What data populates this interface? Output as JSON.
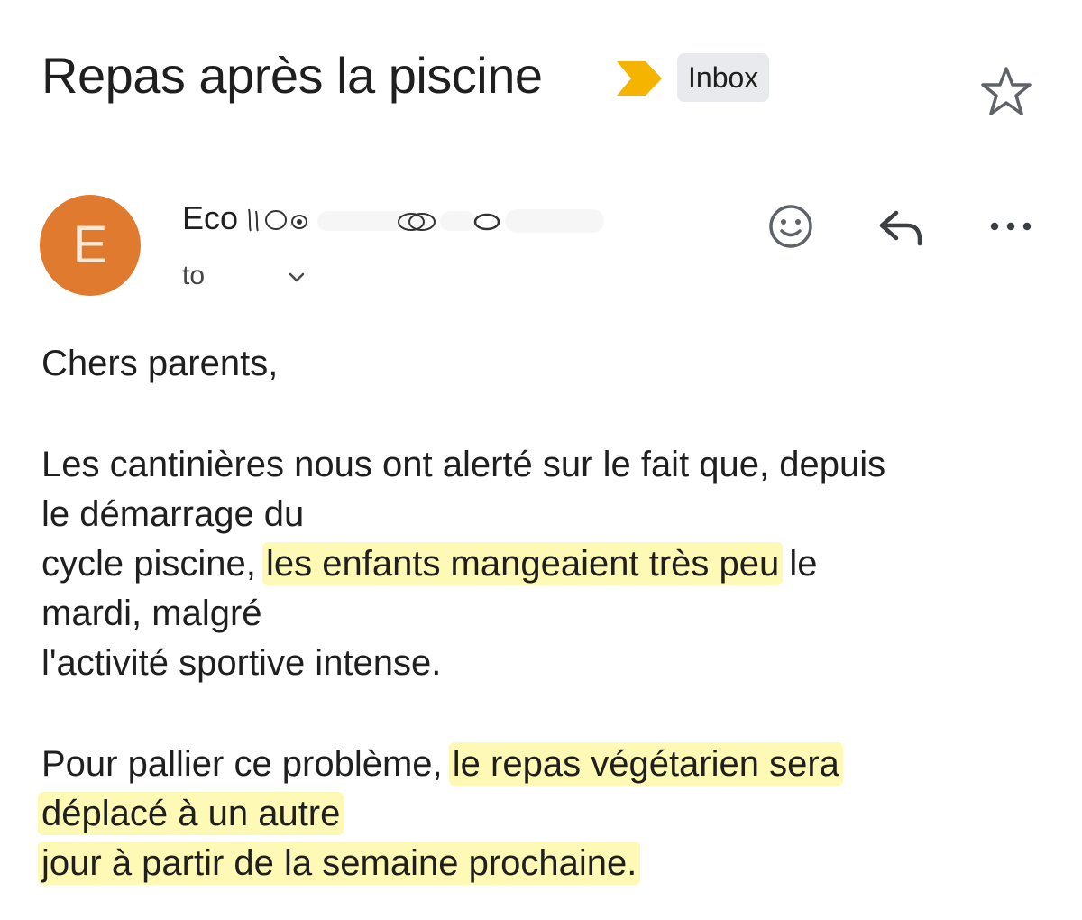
{
  "header": {
    "subject": "Repas après la piscine",
    "label": "Inbox",
    "importance_color": "#f4b400"
  },
  "message": {
    "avatar_letter": "E",
    "avatar_color": "#e07a2f",
    "sender_visible": "Eco",
    "to_label": "to",
    "actions": [
      "emoji-reaction-icon",
      "reply-icon",
      "more-options-icon"
    ]
  },
  "body": {
    "greeting": "Chers parents,",
    "p1": {
      "l1": "Les cantinières nous ont alerté sur le fait que, depuis",
      "l2": "le démarrage du",
      "l3_before": "cycle piscine, ",
      "l3_highlight": "les enfants mangeaient très peu",
      "l3_after": " le",
      "l4": "mardi, malgré",
      "l5": "l'activité sportive intense."
    },
    "p2": {
      "l1_before": "Pour pallier ce problème, ",
      "l1_highlight": "le repas végétarien sera",
      "l2_highlight": "déplacé à un autre",
      "l3_highlight": "jour à partir de la semaine prochaine."
    },
    "highlight_color": "#fff050"
  }
}
